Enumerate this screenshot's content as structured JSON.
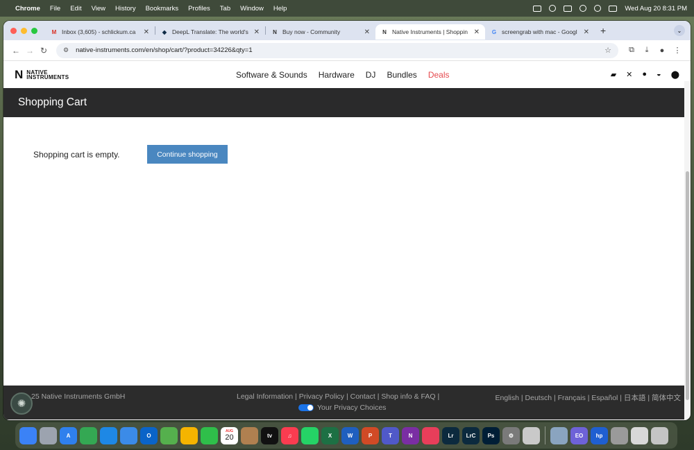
{
  "menubar": {
    "app": "Chrome",
    "items": [
      "File",
      "Edit",
      "View",
      "History",
      "Bookmarks",
      "Profiles",
      "Tab",
      "Window",
      "Help"
    ],
    "datetime": "Wed Aug 20  8:31 PM"
  },
  "tabs": [
    {
      "label": "Inbox (3,605) - schlickum.ca",
      "favicon": "M",
      "color": "#d93025"
    },
    {
      "label": "DeepL Translate: The world's",
      "favicon": "◆",
      "color": "#0f2b46"
    },
    {
      "label": "Buy now - Community",
      "favicon": "N",
      "color": "#111111"
    },
    {
      "label": "Native Instruments | Shoppin",
      "favicon": "N",
      "color": "#111111"
    },
    {
      "label": "screengrab with mac - Googl",
      "favicon": "G",
      "color": "#4285f4"
    }
  ],
  "url": "native-instruments.com/en/shop/cart/?product=34226&qty=1",
  "site": {
    "logo_mark": "N",
    "logo_line1": "NATIVE",
    "logo_line2": "INSTRUMENTS",
    "nav": {
      "software": "Software & Sounds",
      "hardware": "Hardware",
      "dj": "DJ",
      "bundles": "Bundles",
      "deals": "Deals"
    },
    "accent_deals": "#e5484d"
  },
  "cart": {
    "title": "Shopping Cart",
    "empty_message": "Shopping cart is empty.",
    "continue_label": "Continue shopping",
    "button_color": "#4a87c0"
  },
  "footer": {
    "copyright": "25 Native Instruments GmbH",
    "legal": "Legal Information | Privacy Policy | Contact | Shop info & FAQ |",
    "privacy_choices": "Your Privacy Choices",
    "languages": "English | Deutsch | Français | Español | 日本語 | 简体中文"
  },
  "dock": {
    "calendar_month": "AUG",
    "calendar_day": "20",
    "apps": [
      {
        "name": "finder-icon",
        "color": "#3b82f6",
        "glyph": ""
      },
      {
        "name": "launchpad-icon",
        "color": "#9ca3af",
        "glyph": ""
      },
      {
        "name": "app-store-icon",
        "color": "#2f80ed",
        "glyph": "A"
      },
      {
        "name": "chrome-icon",
        "color": "#34a853",
        "glyph": ""
      },
      {
        "name": "safari-icon",
        "color": "#1e88e5",
        "glyph": ""
      },
      {
        "name": "mail-icon",
        "color": "#3b8be8",
        "glyph": ""
      },
      {
        "name": "outlook-icon",
        "color": "#0a64c8",
        "glyph": "O"
      },
      {
        "name": "maps-icon",
        "color": "#55b04d",
        "glyph": ""
      },
      {
        "name": "photos-icon",
        "color": "#f5b400",
        "glyph": ""
      },
      {
        "name": "facetime-icon",
        "color": "#2fbf4a",
        "glyph": ""
      },
      {
        "name": "calendar-icon",
        "color": "#ffffff",
        "glyph": ""
      },
      {
        "name": "keychain-icon",
        "color": "#b08050",
        "glyph": ""
      },
      {
        "name": "apple-tv-icon",
        "color": "#111111",
        "glyph": "tv"
      },
      {
        "name": "music-icon",
        "color": "#fa3c50",
        "glyph": "♫"
      },
      {
        "name": "whatsapp-icon",
        "color": "#25d366",
        "glyph": ""
      },
      {
        "name": "excel-icon",
        "color": "#1d7044",
        "glyph": "X"
      },
      {
        "name": "word-icon",
        "color": "#1f5fbf",
        "glyph": "W"
      },
      {
        "name": "powerpoint-icon",
        "color": "#d04a26",
        "glyph": "P"
      },
      {
        "name": "teams-icon",
        "color": "#5059c9",
        "glyph": "T"
      },
      {
        "name": "onenote-icon",
        "color": "#7a2ea3",
        "glyph": "N"
      },
      {
        "name": "creative-cloud-icon",
        "color": "#e83e5a",
        "glyph": ""
      },
      {
        "name": "lightroom-icon",
        "color": "#0c2a3e",
        "glyph": "Lr"
      },
      {
        "name": "lightroom-classic-icon",
        "color": "#0c2a3e",
        "glyph": "LrC"
      },
      {
        "name": "photoshop-icon",
        "color": "#001e36",
        "glyph": "Ps"
      },
      {
        "name": "system-settings-icon",
        "color": "#7a7a7a",
        "glyph": "⚙"
      },
      {
        "name": "iphone-mirroring-icon",
        "color": "#c9c9c9",
        "glyph": ""
      },
      {
        "name": "preview-icon",
        "color": "#8aa4c0",
        "glyph": ""
      },
      {
        "name": "ebook-icon",
        "color": "#6e62d8",
        "glyph": "EO"
      },
      {
        "name": "hp-icon",
        "color": "#1f5fd1",
        "glyph": "hp"
      },
      {
        "name": "printer-icon",
        "color": "#9a9a9a",
        "glyph": ""
      },
      {
        "name": "documents-folder-icon",
        "color": "#d8d8d8",
        "glyph": ""
      },
      {
        "name": "trash-icon",
        "color": "#c4c4c4",
        "glyph": ""
      }
    ]
  }
}
